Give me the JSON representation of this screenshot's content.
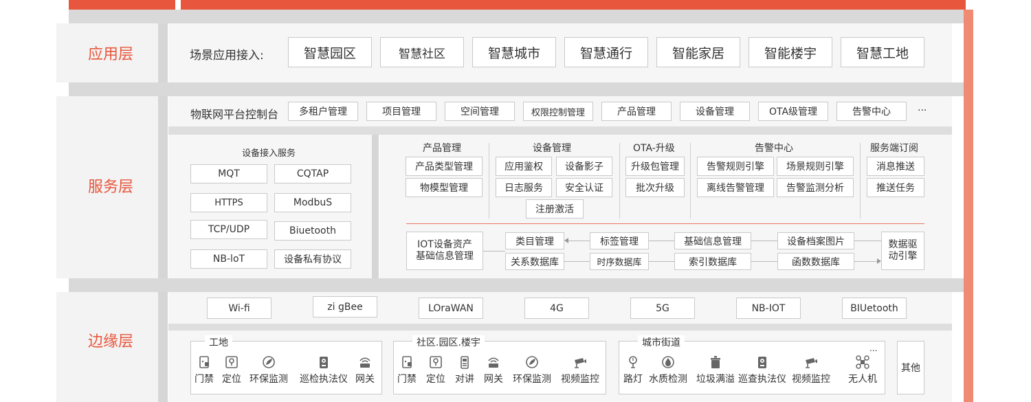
{
  "colors": {
    "accent": "#e8573d",
    "panel": "#f3f3f3",
    "border": "#c9c9c9"
  },
  "layers": {
    "app": "应用层",
    "service": "服务层",
    "edge": "边缘层"
  },
  "app_layer": {
    "label": "场景应用接入:",
    "items": [
      "智慧园区",
      "智慧社区",
      "智慧城市",
      "智慧通行",
      "智能家居",
      "智能楼宇",
      "智慧工地"
    ]
  },
  "console": {
    "label": "物联网平台控制台",
    "items": [
      "多租户管理",
      "项目管理",
      "空间管理",
      "权限控制管理",
      "产品管理",
      "设备管理",
      "OTA级管理",
      "告警中心"
    ],
    "more": "···"
  },
  "access": {
    "title": "设备接入服务",
    "protocols": [
      "MQT",
      "CQTAP",
      "HTTPS",
      "ModbuS",
      "TCP/UDP",
      "Biuetooth",
      "NB-loT",
      "设备私有协议"
    ]
  },
  "modules": {
    "product": {
      "title": "产品管理",
      "items": [
        "产品类型管理",
        "物模型管理"
      ]
    },
    "device": {
      "title": "设备管理",
      "items": [
        "应用鉴权",
        "设备影子",
        "日志服务",
        "安全认证",
        "注册激活"
      ]
    },
    "ota": {
      "title": "OTA-升级",
      "items": [
        "升级包管理",
        "批次升级"
      ]
    },
    "alarm": {
      "title": "告警中心",
      "items": [
        "告警规则引擎",
        "场景规则引擎",
        "离线告警管理",
        "告警监测分析"
      ]
    },
    "subscribe": {
      "title": "服务端订阅",
      "items": [
        "消息推送",
        "推送任务"
      ]
    }
  },
  "assets": {
    "source": "IOT设备资产\n基础信息管理",
    "row1": [
      "类目管理",
      "标签管理",
      "基础信息管理",
      "设备档案图片"
    ],
    "row2": [
      "关系数据库",
      "时序数据库",
      "索引数据库",
      "函数数据库"
    ],
    "engine": "数据驱\n动引擎"
  },
  "network": [
    "Wi-fi",
    "zi gBee",
    "LOraWAN",
    "4G",
    "5G",
    "NB-IOT",
    "BIUetooth"
  ],
  "edge_groups": {
    "site": {
      "title": "工地",
      "devices": [
        {
          "label": "门禁",
          "icon": "door-access-icon"
        },
        {
          "label": "定位",
          "icon": "location-icon"
        },
        {
          "label": "环保监测",
          "icon": "leaf-icon"
        },
        {
          "label": "巡检执法仪",
          "icon": "recorder-icon"
        },
        {
          "label": "网关",
          "icon": "gateway-icon"
        }
      ]
    },
    "community": {
      "title": "社区.园区.楼宇",
      "devices": [
        {
          "label": "门禁",
          "icon": "door-access-icon"
        },
        {
          "label": "定位",
          "icon": "location-icon"
        },
        {
          "label": "对讲",
          "icon": "intercom-icon"
        },
        {
          "label": "网关",
          "icon": "gateway-icon"
        },
        {
          "label": "环保监测",
          "icon": "leaf-icon"
        },
        {
          "label": "视频监控",
          "icon": "camera-icon"
        }
      ]
    },
    "city": {
      "title": "城市街道",
      "more": "...",
      "devices": [
        {
          "label": "路灯",
          "icon": "streetlight-icon"
        },
        {
          "label": "水质检测",
          "icon": "water-icon"
        },
        {
          "label": "垃圾满溢",
          "icon": "trash-icon"
        },
        {
          "label": "巡查执法仪",
          "icon": "recorder-icon"
        },
        {
          "label": "视频监控",
          "icon": "camera-icon"
        },
        {
          "label": "无人机",
          "icon": "drone-icon"
        }
      ]
    },
    "other": "其他"
  }
}
